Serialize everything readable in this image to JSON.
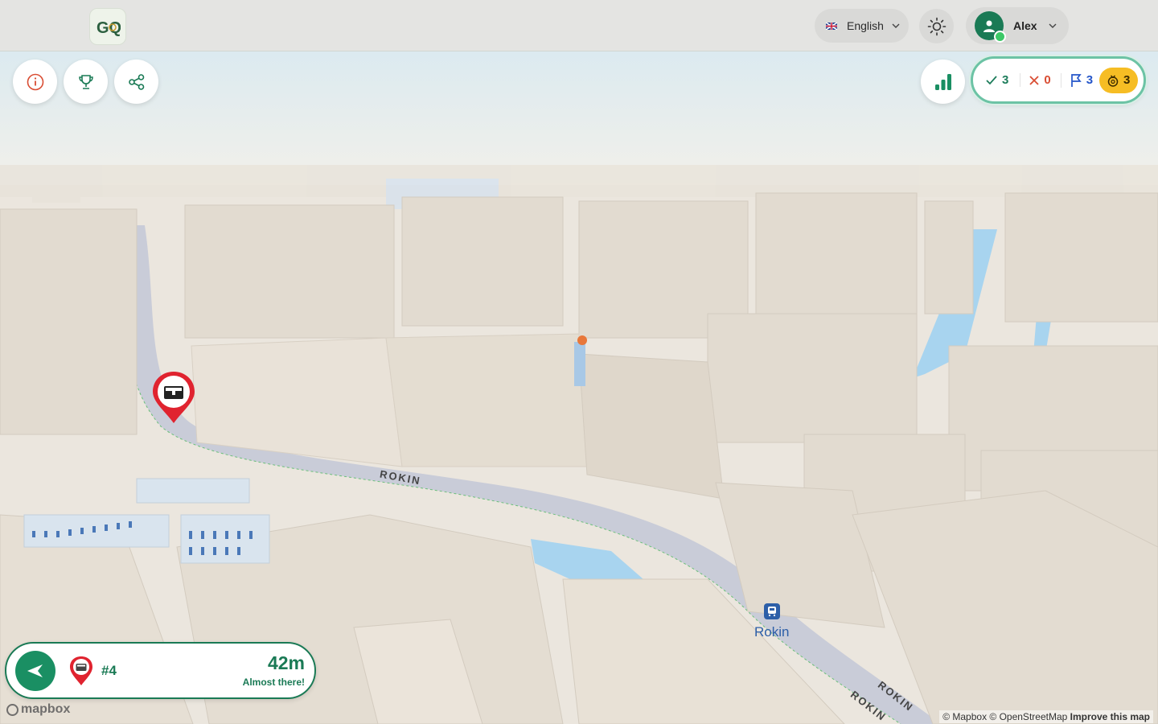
{
  "header": {
    "logo_text": "GQ",
    "language": "English",
    "user_name": "Alex"
  },
  "toolbar_left": {
    "buttons": [
      {
        "icon": "info-icon"
      },
      {
        "icon": "trophy-icon"
      },
      {
        "icon": "share-icon"
      }
    ]
  },
  "stats": {
    "icon": "stats-bar-icon",
    "correct": "3",
    "wrong": "0",
    "flags": "3",
    "coins": "3"
  },
  "map": {
    "streets": [
      "ROKIN",
      "ROKIN",
      "ROKIN"
    ],
    "station": "Rokin",
    "marker_icon": "treasure-chest-icon",
    "colors": {
      "building": "#e2dbd0",
      "water": "#a8d4ef",
      "road": "#c9ccd8",
      "marker": "#e0232f",
      "brand": "#1a7a55",
      "coin": "#f6bd24"
    }
  },
  "navigation": {
    "target": "#4",
    "distance": "42m",
    "message": "Almost there!"
  },
  "footer": {
    "mapbox": "mapbox",
    "attribution": "© Mapbox © OpenStreetMap",
    "improve": "Improve this map"
  }
}
